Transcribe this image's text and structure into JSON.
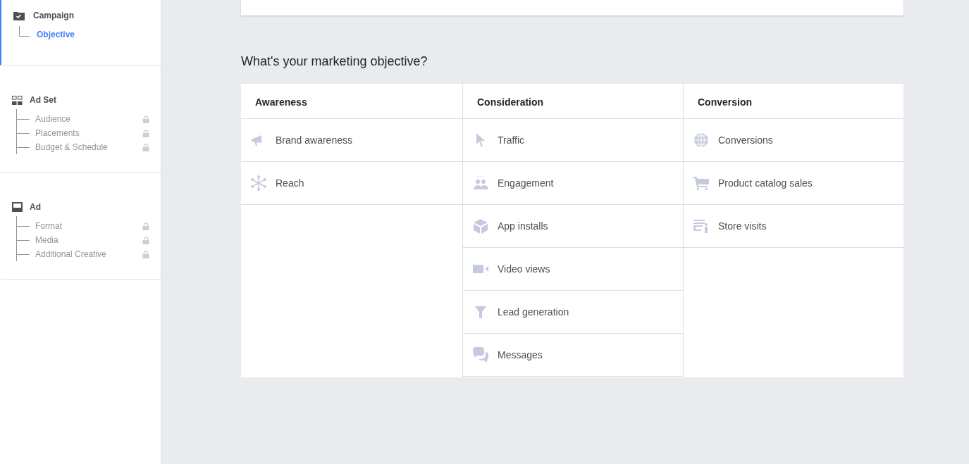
{
  "sidebar": {
    "sections": [
      {
        "title": "Campaign",
        "active": true,
        "children": [
          {
            "label": "Objective",
            "selected": true,
            "locked": false
          }
        ]
      },
      {
        "title": "Ad Set",
        "active": false,
        "children": [
          {
            "label": "Audience",
            "selected": false,
            "locked": true
          },
          {
            "label": "Placements",
            "selected": false,
            "locked": true
          },
          {
            "label": "Budget & Schedule",
            "selected": false,
            "locked": true
          }
        ]
      },
      {
        "title": "Ad",
        "active": false,
        "children": [
          {
            "label": "Format",
            "selected": false,
            "locked": true
          },
          {
            "label": "Media",
            "selected": false,
            "locked": true
          },
          {
            "label": "Additional Creative",
            "selected": false,
            "locked": true
          }
        ]
      }
    ]
  },
  "heading": "What's your marketing objective?",
  "objectives": [
    {
      "category": "Awareness",
      "items": [
        "Brand awareness",
        "Reach"
      ]
    },
    {
      "category": "Consideration",
      "items": [
        "Traffic",
        "Engagement",
        "App installs",
        "Video views",
        "Lead generation",
        "Messages"
      ]
    },
    {
      "category": "Conversion",
      "items": [
        "Conversions",
        "Product catalog sales",
        "Store visits"
      ]
    }
  ]
}
